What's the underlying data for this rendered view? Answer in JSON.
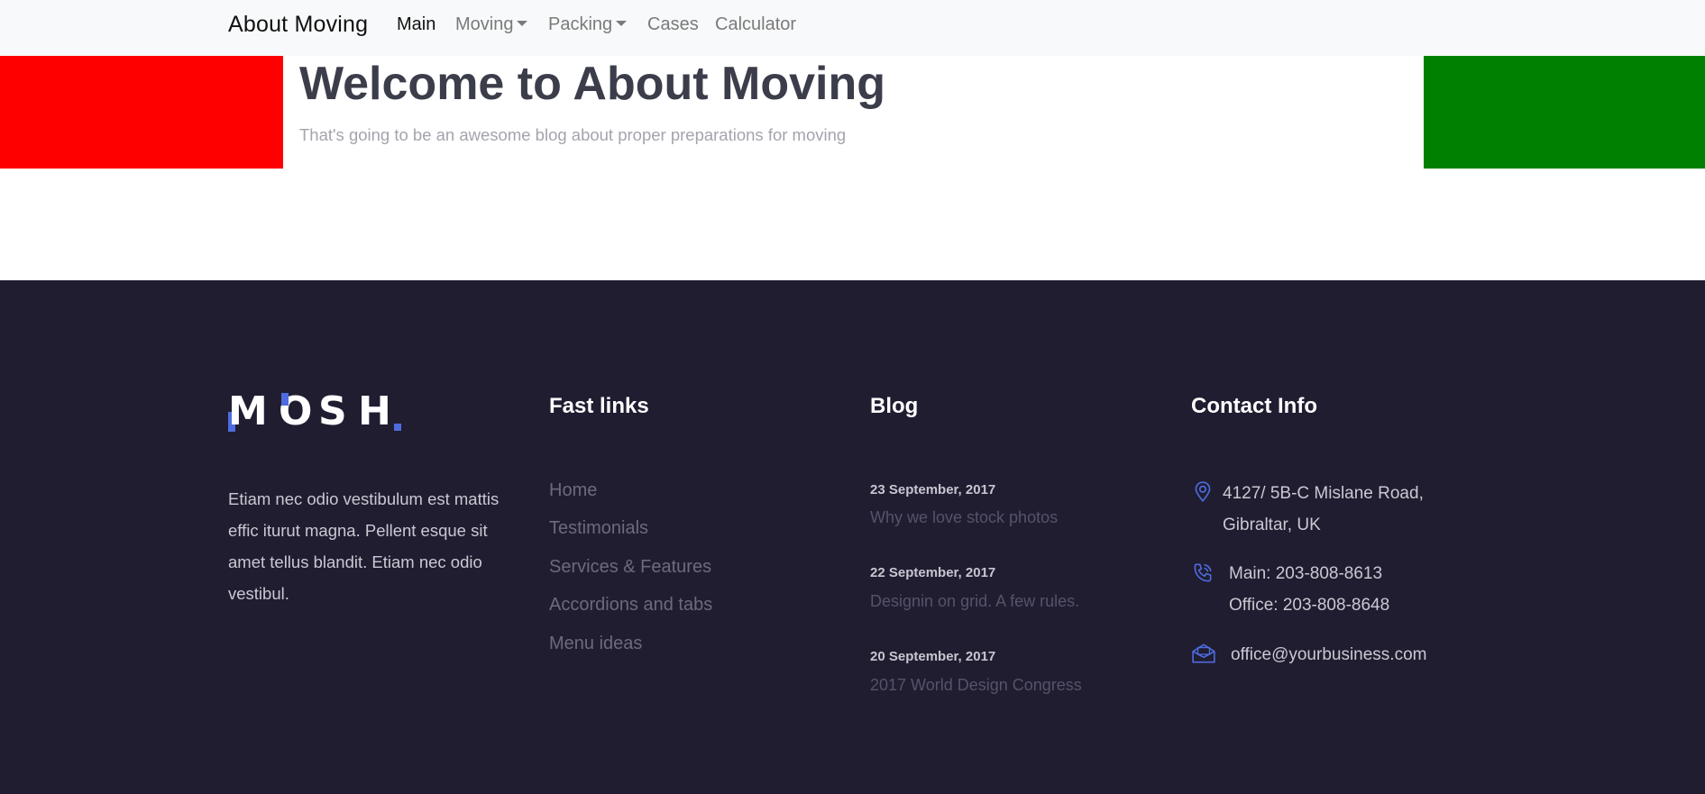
{
  "navbar": {
    "brand": "About Moving",
    "items": [
      {
        "label": "Main",
        "active": true
      },
      {
        "label": "Moving",
        "dropdown": true
      },
      {
        "label": "Packing",
        "dropdown": true
      },
      {
        "label": "Cases"
      },
      {
        "label": "Calculator"
      }
    ]
  },
  "hero": {
    "title": "Welcome to About Moving",
    "subtitle": "That's going to be an awesome blog about proper preparations for moving",
    "left_block_color": "#ff0000",
    "right_block_color": "#008000"
  },
  "footer": {
    "background": "#201d31",
    "accent_color": "#4e6ce0",
    "logo": "MOSH.",
    "about_text": "Etiam nec odio vestibulum est mattis effic iturut magna. Pellent esque sit amet tellus blandit. Etiam nec odio vestibul.",
    "fast_links": {
      "title": "Fast links",
      "items": [
        "Home",
        "Testimonials",
        "Services & Features",
        "Accordions and tabs",
        "Menu ideas"
      ]
    },
    "blog": {
      "title": "Blog",
      "posts": [
        {
          "date": "23 September, 2017",
          "title": "Why we love stock photos"
        },
        {
          "date": "22 September, 2017",
          "title": "Designin on grid. A few rules."
        },
        {
          "date": "20 September, 2017",
          "title": "2017 World Design Congress"
        }
      ]
    },
    "contact": {
      "title": "Contact Info",
      "address_line1": "4127/ 5B-C Mislane Road,",
      "address_line2": "Gibraltar, UK",
      "phone_main": "Main: 203-808-8613",
      "phone_office": "Office: 203-808-8648",
      "email": "office@yourbusiness.com",
      "icons": [
        "location-pin-icon",
        "phone-icon",
        "envelope-icon"
      ]
    }
  }
}
